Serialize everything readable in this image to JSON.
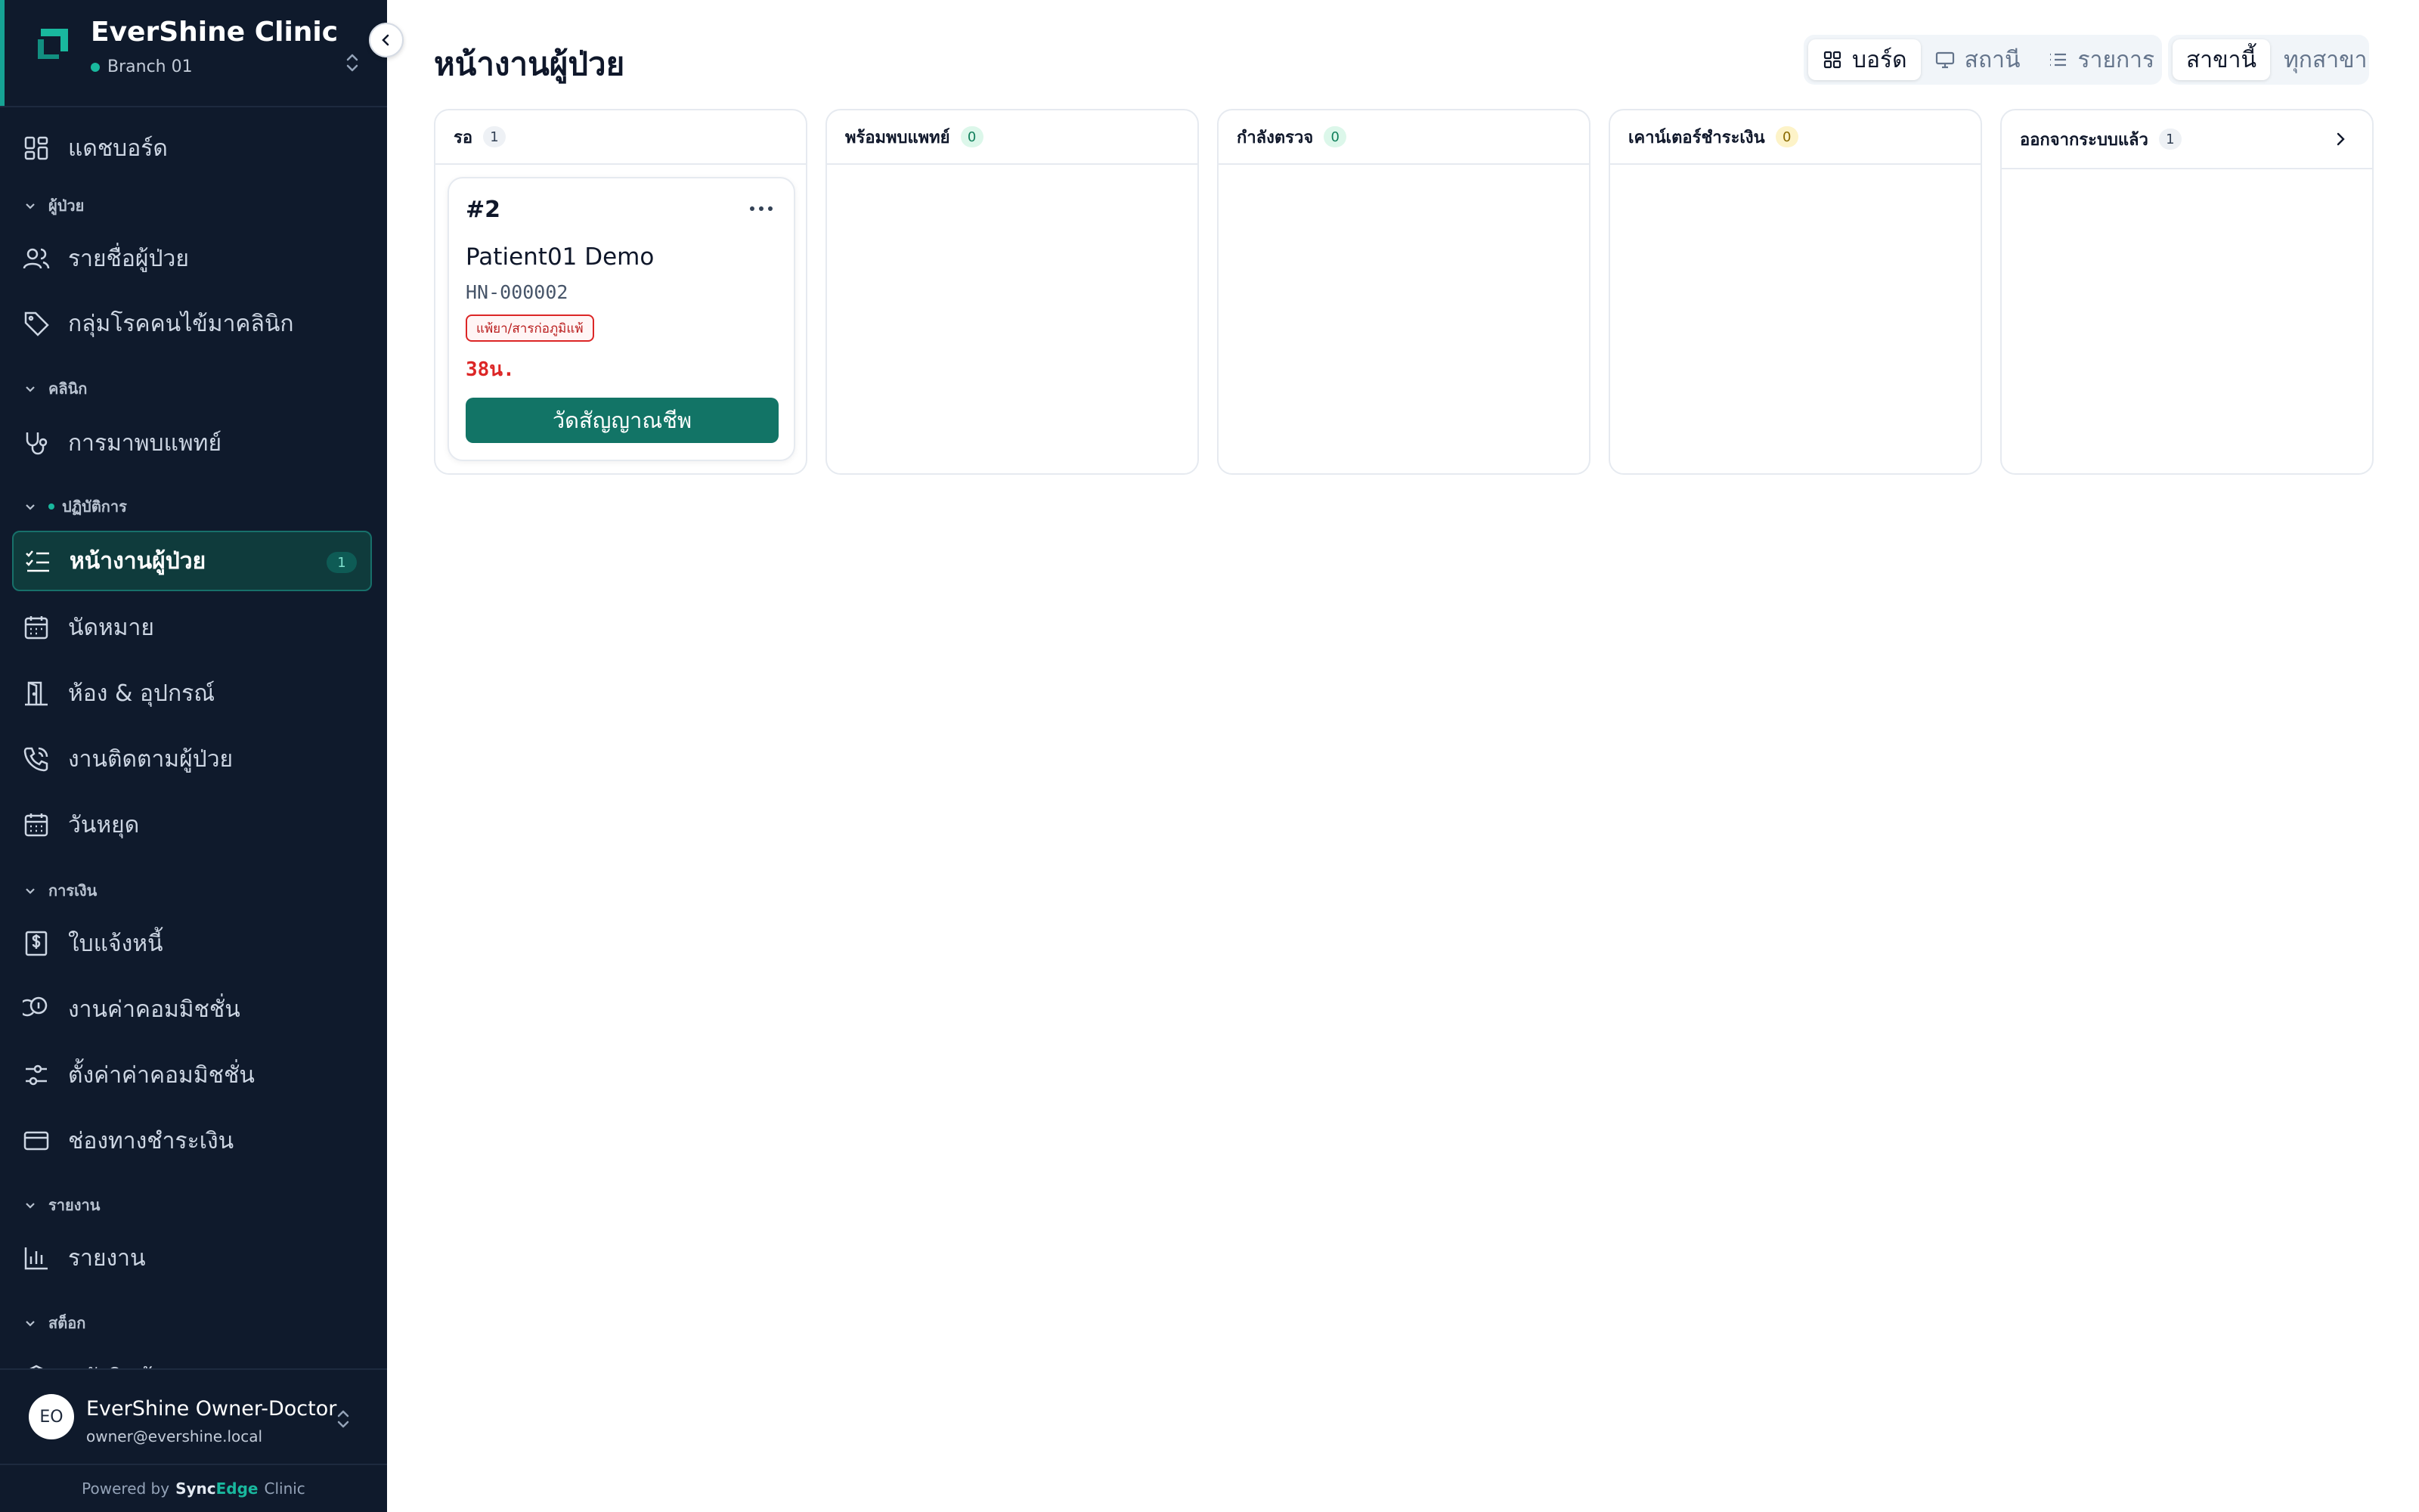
{
  "app": {
    "name": "EverShine Clinic",
    "branch": "Branch 01"
  },
  "sidebar": {
    "items": {
      "dashboard": "แดชบอร์ด",
      "patient_list": "รายชื่อผู้ป่วย",
      "chronic_groups": "กลุ่มโรคคนไข้มาคลินิก",
      "doctor_visits": "การมาพบแพทย์",
      "patient_queue": "หน้างานผู้ป่วย",
      "appointments": "นัดหมาย",
      "rooms": "ห้อง & อุปกรณ์",
      "followup": "งานติดตามผู้ป่วย",
      "holidays": "วันหยุด",
      "invoices": "ใบแจ้งหนี้",
      "commission_jobs": "งานค่าคอมมิชชั่น",
      "commission_settings": "ตั้งค่าค่าคอมมิชชั่น",
      "payment_channels": "ช่องทางชำระเงิน",
      "reports": "รายงาน",
      "stock_partial": "คลังสินค้า"
    },
    "sections": {
      "patients": "ผู้ป่วย",
      "clinic": "คลินิก",
      "operations": "ปฏิบัติการ",
      "finance": "การเงิน",
      "reports": "รายงาน",
      "stock": "สต็อก"
    },
    "queue_count": "1",
    "user": {
      "initials": "EO",
      "name": "EverShine Owner-Doctor",
      "email": "owner@evershine.local"
    },
    "powered": {
      "prefix": "Powered by",
      "brand_a": "Sync",
      "brand_b": "Edge",
      "brand_c": "Clinic"
    }
  },
  "main": {
    "title": "หน้างานผู้ป่วย",
    "view_options": [
      "บอร์ด",
      "สถานี",
      "รายการ"
    ],
    "view_selected": "บอร์ด",
    "scope_options": [
      "สาขานี้",
      "ทุกสาขา"
    ],
    "scope_selected": "สาขานี้",
    "columns": [
      {
        "title": "รอ",
        "count": "1"
      },
      {
        "title": "พร้อมพบแพทย์",
        "count": "0"
      },
      {
        "title": "กำลังตรวจ",
        "count": "0"
      },
      {
        "title": "เคาน์เตอร์ชำระเงิน",
        "count": "0"
      },
      {
        "title": "ออกจากระบบแล้ว",
        "count": "1"
      }
    ],
    "card": {
      "queue_no": "#2",
      "patient_name": "Patient01 Demo",
      "hn": "HN-000002",
      "tag": "แพ้ยา/สารก่อภูมิแพ้",
      "elapsed": "38น.",
      "action": "วัดสัญญาณชีพ"
    }
  },
  "colors": {
    "sidebar_bg": "#0f1a2c",
    "accent": "#16a394",
    "primary_button": "#127466",
    "danger": "#dc2626"
  }
}
